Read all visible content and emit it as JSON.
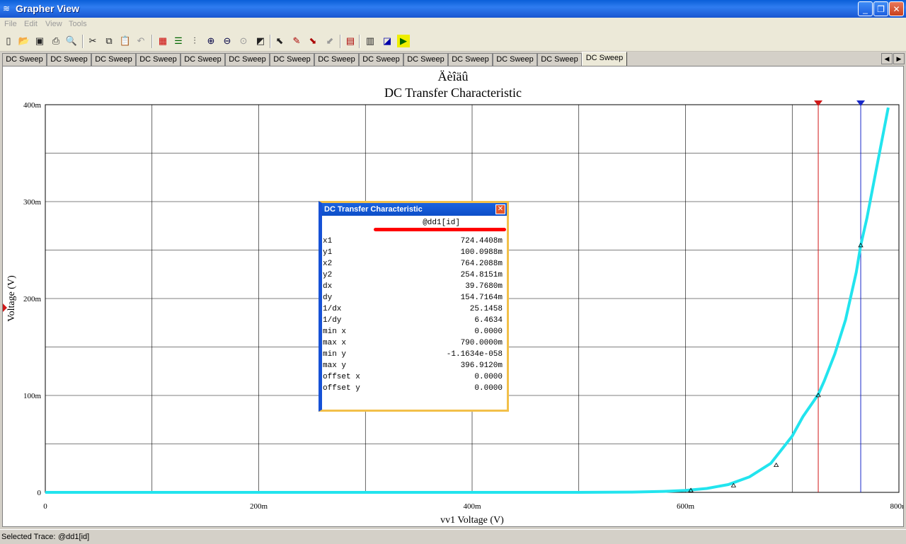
{
  "window": {
    "title": "Grapher View",
    "controls": {
      "minimize": "_",
      "maximize": "❐",
      "close": "✕"
    }
  },
  "menu": [
    "File",
    "Edit",
    "View",
    "Tools"
  ],
  "toolbar": {
    "icons": [
      "new-icon",
      "open-icon",
      "save-icon",
      "print-icon",
      "print-preview-icon",
      "cut-icon",
      "copy-icon",
      "paste-icon",
      "undo-icon",
      "grid-icon",
      "legend-icon",
      "cursors-icon",
      "zoom-in-icon",
      "zoom-out-icon",
      "zoom-full-icon",
      "reverse-colors-icon",
      "select-marks-icon",
      "select-trace-icon",
      "copy-graph-icon",
      "paste-graph-icon",
      "export-excel-icon",
      "export-lvm-icon",
      "overlay-traces-icon",
      "exit-icon"
    ]
  },
  "tabs": {
    "labels": [
      "DC Sweep",
      "DC Sweep",
      "DC Sweep",
      "DC Sweep",
      "DC Sweep",
      "DC Sweep",
      "DC Sweep",
      "DC Sweep",
      "DC Sweep",
      "DC Sweep",
      "DC Sweep",
      "DC Sweep",
      "DC Sweep",
      "DC Sweep"
    ],
    "active_index": 13,
    "scroll_left": "◀",
    "scroll_right": "▶"
  },
  "chart_data": {
    "type": "line",
    "title": "Äèîäû",
    "subtitle": "DC Transfer Characteristic",
    "xlabel": "vv1 Voltage (V)",
    "ylabel": "Voltage (V)",
    "xlim": [
      0,
      0.8
    ],
    "ylim": [
      0,
      0.4
    ],
    "x_ticks": [
      0,
      0.2,
      0.4,
      0.6,
      0.8
    ],
    "x_tick_labels": [
      "0",
      "200m",
      "400m",
      "600m",
      "800m"
    ],
    "y_ticks": [
      0,
      0.1,
      0.2,
      0.3,
      0.4
    ],
    "y_tick_labels": [
      "0",
      "100m",
      "200m",
      "300m",
      "400m"
    ],
    "grid": true,
    "series": [
      {
        "trace": "@dd1[id]",
        "color": "#22e4ee",
        "x": [
          0,
          0.1,
          0.2,
          0.3,
          0.4,
          0.5,
          0.55,
          0.58,
          0.6,
          0.62,
          0.64,
          0.66,
          0.68,
          0.7,
          0.71,
          0.72,
          0.7244,
          0.73,
          0.74,
          0.75,
          0.76,
          0.7642,
          0.77,
          0.78,
          0.79
        ],
        "values": [
          0,
          0,
          0,
          0,
          0,
          0,
          0.0003,
          0.001,
          0.002,
          0.004,
          0.008,
          0.016,
          0.03,
          0.058,
          0.078,
          0.094,
          0.101,
          0.115,
          0.143,
          0.178,
          0.227,
          0.2548,
          0.283,
          0.34,
          0.397
        ],
        "markers": [
          {
            "x": 0.605,
            "y": 0.002
          },
          {
            "x": 0.645,
            "y": 0.007
          },
          {
            "x": 0.685,
            "y": 0.028
          },
          {
            "x": 0.7244,
            "y": 0.1001
          },
          {
            "x": 0.7642,
            "y": 0.2548
          }
        ]
      }
    ],
    "cursors": [
      {
        "name": "cursor-1",
        "x": 0.7244,
        "color": "#d01818"
      },
      {
        "name": "cursor-2",
        "x": 0.7642,
        "color": "#1828c8"
      }
    ]
  },
  "cursor_window": {
    "title": "DC Transfer Characteristic",
    "close": "✕",
    "trace": "@dd1[id]",
    "rows": [
      {
        "label": "x1",
        "value": "724.4408m"
      },
      {
        "label": "y1",
        "value": "100.0988m"
      },
      {
        "label": "x2",
        "value": "764.2088m"
      },
      {
        "label": "y2",
        "value": "254.8151m"
      },
      {
        "label": "dx",
        "value": "39.7680m"
      },
      {
        "label": "dy",
        "value": "154.7164m"
      },
      {
        "label": "1/dx",
        "value": "25.1458"
      },
      {
        "label": "1/dy",
        "value": "6.4634"
      },
      {
        "label": "min x",
        "value": "0.0000"
      },
      {
        "label": "max x",
        "value": "790.0000m"
      },
      {
        "label": "min y",
        "value": "-1.1634e-058"
      },
      {
        "label": "max y",
        "value": "396.9120m"
      },
      {
        "label": "offset x",
        "value": "0.0000"
      },
      {
        "label": "offset y",
        "value": "0.0000"
      }
    ]
  },
  "status": {
    "label": "Selected Trace:",
    "value": "@dd1[id]"
  }
}
